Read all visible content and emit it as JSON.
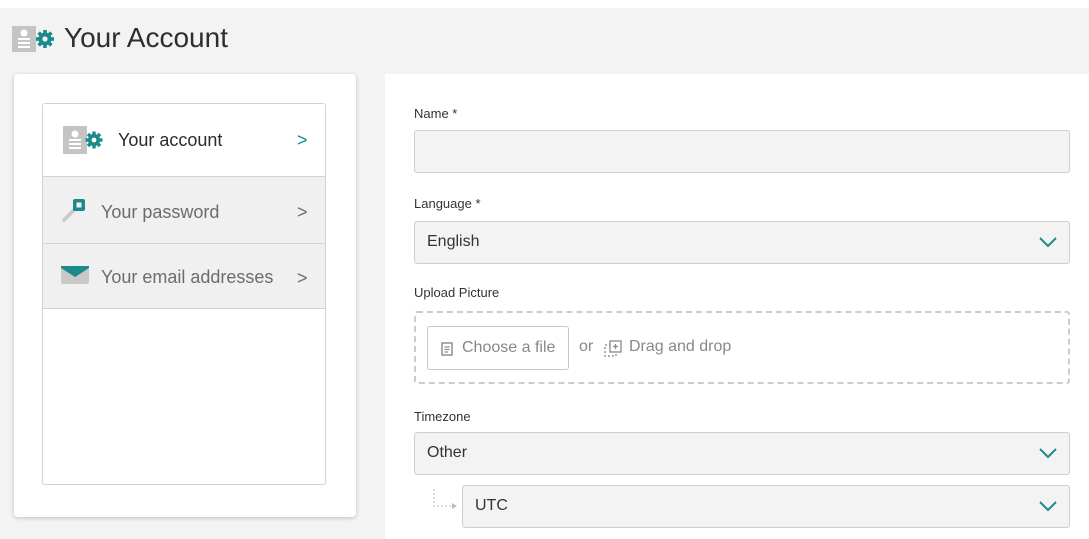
{
  "header": {
    "title": "Your Account",
    "icon": "account-settings-icon"
  },
  "sidebar": {
    "items": [
      {
        "label": "Your account",
        "icon": "account-settings-icon",
        "active": true
      },
      {
        "label": "Your password",
        "icon": "key-icon",
        "active": false
      },
      {
        "label": "Your email addresses",
        "icon": "envelope-icon",
        "active": false
      }
    ],
    "chevron": ">"
  },
  "form": {
    "name": {
      "label": "Name *",
      "value": ""
    },
    "language": {
      "label": "Language *",
      "value": "English"
    },
    "upload": {
      "label": "Upload Picture",
      "choose_label": "Choose a file",
      "or_label": "or",
      "drag_label": "Drag and drop"
    },
    "timezone": {
      "label": "Timezone",
      "region": "Other",
      "zone": "UTC"
    }
  },
  "colors": {
    "accent": "#1a8a8a",
    "background": "#f3f3f3",
    "icon_gray": "#c2c2c2"
  }
}
